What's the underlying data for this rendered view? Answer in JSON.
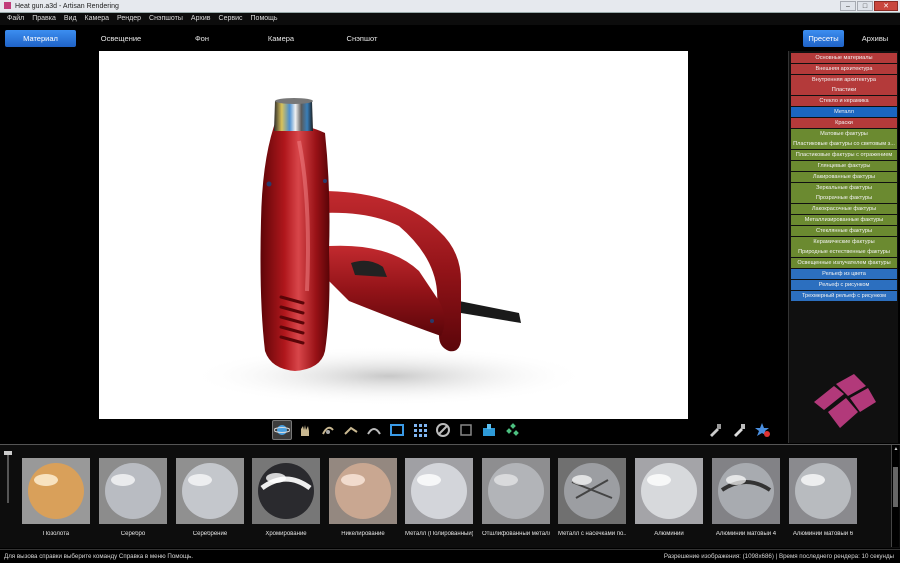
{
  "window": {
    "title": "Heat gun.a3d - Artisan Rendering",
    "controls": [
      "–",
      "□",
      "✕"
    ]
  },
  "menu": [
    "Файл",
    "Правка",
    "Вид",
    "Камера",
    "Рендер",
    "Снэпшоты",
    "Архив",
    "Сервис",
    "Помощь"
  ],
  "nav": {
    "tabs": [
      "Материал",
      "Освещение",
      "Фон",
      "Камера",
      "Снэпшот"
    ],
    "active_tab": "Материал",
    "right_tabs": [
      "Пресеты",
      "Архивы"
    ],
    "active_right_tab": "Пресеты"
  },
  "presets": [
    {
      "label": "Основные материалы",
      "color": "red"
    },
    {
      "label": "Внешняя архитектура",
      "color": "red"
    },
    {
      "label": "Внутренняя архитектура",
      "color": "red"
    },
    {
      "label": "Пластики",
      "color": "red"
    },
    {
      "label": "Стекло и керамика",
      "color": "red"
    },
    {
      "label": "Металл",
      "color": "selected"
    },
    {
      "label": "Краски",
      "color": "red"
    },
    {
      "label": "Матовые фактуры",
      "color": "green"
    },
    {
      "label": "Пластиковые фактуры со световым з...",
      "color": "green"
    },
    {
      "label": "Пластиковые фактуры с отражением",
      "color": "green"
    },
    {
      "label": "Глянцевые фактуры",
      "color": "green"
    },
    {
      "label": "Лакированные фактуры",
      "color": "green"
    },
    {
      "label": "Зеркальные фактуры",
      "color": "green"
    },
    {
      "label": "Прозрачные фактуры",
      "color": "green"
    },
    {
      "label": "Лакокрасочные фактуры",
      "color": "green"
    },
    {
      "label": "Металлизированные фактуры",
      "color": "green"
    },
    {
      "label": "Стеклянные фактуры",
      "color": "green"
    },
    {
      "label": "Керамические фактуры",
      "color": "green"
    },
    {
      "label": "Природные естественные фактуры",
      "color": "green"
    },
    {
      "label": "Освещенные излучателем фактуры",
      "color": "green"
    },
    {
      "label": "Рельеф из цвета",
      "color": "blue"
    },
    {
      "label": "Рельеф с рисунком",
      "color": "blue"
    },
    {
      "label": "Трехмерный рельеф с рисунком",
      "color": "blue"
    }
  ],
  "toolbar": {
    "tools": [
      "planet-icon",
      "hand-pan-icon",
      "rotate-object-icon",
      "move-object-icon",
      "arc-icon",
      "frame-icon",
      "grid-icon",
      "no-entry-icon",
      "crop-icon",
      "material-apply-icon",
      "scatter-icon"
    ],
    "side_tools": [
      "eyedropper-icon",
      "eyedropper-plus-icon",
      "favorite-star-icon"
    ]
  },
  "materials": [
    {
      "label": "Позолота",
      "tint": "#d9a05a"
    },
    {
      "label": "Серебро",
      "tint": "#b9bcc2"
    },
    {
      "label": "Серебрение",
      "tint": "#c4c7cc"
    },
    {
      "label": "Хромирование",
      "tint": "#8a8e95"
    },
    {
      "label": "Никелирование",
      "tint": "#c9a791"
    },
    {
      "label": "Металл (Полированный)",
      "tint": "#d3d5da"
    },
    {
      "label": "Отшлифованный металл",
      "tint": "#b2b4b8"
    },
    {
      "label": "Металл с насечками по...",
      "tint": "#9c9ea2"
    },
    {
      "label": "Алюминий",
      "tint": "#d7d9dc"
    },
    {
      "label": "Алюминий матовый 4",
      "tint": "#a8abb0"
    },
    {
      "label": "Алюминий матовый 6",
      "tint": "#b8bbbf"
    }
  ],
  "status": {
    "help": "Для вызова справки выберите команду Справка в меню Помощь.",
    "render": "Разрешение изображения: (1098x686)  |  Время последнего рендера: 10 секунды"
  },
  "colors": {
    "accent": "#2f7ae0",
    "product_red": "#a41418",
    "preset_red": "#b43a3a",
    "preset_green": "#6b8a30",
    "preset_blue": "#2c6fbf",
    "logo": "#b2397a"
  }
}
